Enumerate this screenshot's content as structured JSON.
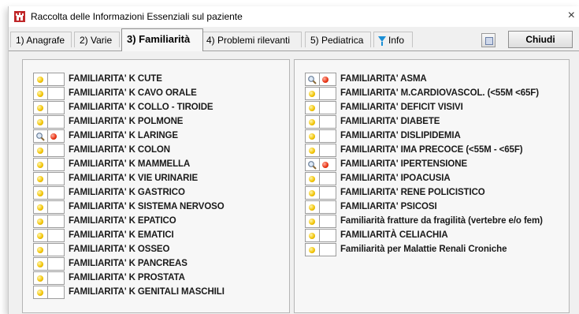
{
  "window": {
    "title": "Raccolta delle Informazioni Essenziali sul paziente",
    "close_glyph": "×"
  },
  "tabs": [
    {
      "label": "1) Anagrafe"
    },
    {
      "label": "2) Varie"
    },
    {
      "label": "3) Familiarità"
    },
    {
      "label": "4) Problemi rilevanti"
    },
    {
      "label": "5) Pediatrica"
    },
    {
      "label": "Info",
      "icon": "info-icon"
    }
  ],
  "active_tab": "3) Familiarità",
  "toolbar": {
    "close_label": "Chiudi",
    "small_button_icon": "window-icon"
  },
  "colors": {
    "yellow": "#f2c300",
    "red": "#e83010",
    "info_blue": "#1a8fd6"
  },
  "left_list": [
    {
      "label": "FAMILIARITA' K CUTE",
      "search": false,
      "status": "none"
    },
    {
      "label": "FAMILIARITA' K CAVO ORALE",
      "search": false,
      "status": "none"
    },
    {
      "label": "FAMILIARITA' K COLLO - TIROIDE",
      "search": false,
      "status": "none"
    },
    {
      "label": "FAMILIARITA' K POLMONE",
      "search": false,
      "status": "none"
    },
    {
      "label": "FAMILIARITA' K LARINGE",
      "search": true,
      "status": "red"
    },
    {
      "label": "FAMILIARITA' K COLON",
      "search": false,
      "status": "none"
    },
    {
      "label": "FAMILIARITA' K MAMMELLA",
      "search": false,
      "status": "none"
    },
    {
      "label": "FAMILIARITA' K VIE URINARIE",
      "search": false,
      "status": "none"
    },
    {
      "label": "FAMILIARITA' K GASTRICO",
      "search": false,
      "status": "none"
    },
    {
      "label": "FAMILIARITA' K SISTEMA NERVOSO",
      "search": false,
      "status": "none"
    },
    {
      "label": "FAMILIARITA' K EPATICO",
      "search": false,
      "status": "none"
    },
    {
      "label": "FAMILIARITA' K EMATICI",
      "search": false,
      "status": "none"
    },
    {
      "label": "FAMILIARITA' K OSSEO",
      "search": false,
      "status": "none"
    },
    {
      "label": "FAMILIARITA' K PANCREAS",
      "search": false,
      "status": "none"
    },
    {
      "label": "FAMILIARITA' K PROSTATA",
      "search": false,
      "status": "none"
    },
    {
      "label": "FAMILIARITA' K GENITALI MASCHILI",
      "search": false,
      "status": "none"
    }
  ],
  "right_list": [
    {
      "label": "FAMILIARITA' ASMA",
      "search": true,
      "status": "red"
    },
    {
      "label": "FAMILIARITA' M.CARDIOVASCOL. (<55M <65F)",
      "search": false,
      "status": "none"
    },
    {
      "label": "FAMILIARITA' DEFICIT VISIVI",
      "search": false,
      "status": "none"
    },
    {
      "label": "FAMILIARITA' DIABETE",
      "search": false,
      "status": "none"
    },
    {
      "label": "FAMILIARITA' DISLIPIDEMIA",
      "search": false,
      "status": "none"
    },
    {
      "label": "FAMILIARITA' IMA PRECOCE (<55M - <65F)",
      "search": false,
      "status": "none"
    },
    {
      "label": "FAMILIARITA' IPERTENSIONE",
      "search": true,
      "status": "red"
    },
    {
      "label": "FAMILIARITA' IPOACUSIA",
      "search": false,
      "status": "none"
    },
    {
      "label": "FAMILIARITA' RENE POLICISTICO",
      "search": false,
      "status": "none"
    },
    {
      "label": "FAMILIARITA' PSICOSI",
      "search": false,
      "status": "none"
    },
    {
      "label": "Familiarità fratture da fragilità (vertebre e/o fem)",
      "search": false,
      "status": "none"
    },
    {
      "label": "FAMILIARITÀ CELIACHIA",
      "search": false,
      "status": "none"
    },
    {
      "label": "Familiarità per Malattie Renali Croniche",
      "search": false,
      "status": "none"
    }
  ]
}
